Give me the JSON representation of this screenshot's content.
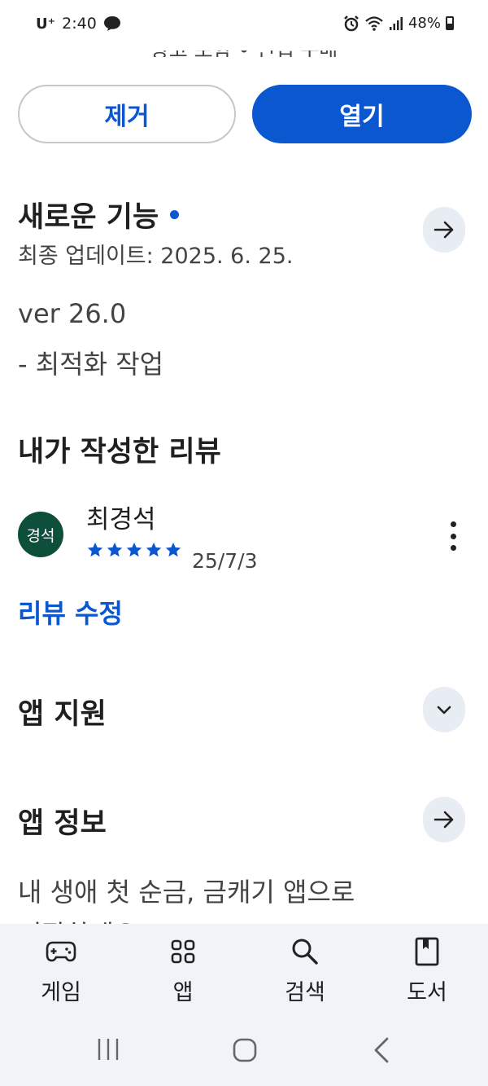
{
  "status_bar": {
    "carrier": "U⁺",
    "time": "2:40",
    "battery": "48%"
  },
  "top_text_cut": "광고 포함 • 인앱 구매",
  "actions": {
    "remove_label": "제거",
    "open_label": "열기"
  },
  "whats_new": {
    "title": "새로운 기능",
    "updated": "최종 업데이트: 2025. 6. 25.",
    "version": "ver 26.0",
    "note": "- 최적화 작업"
  },
  "my_review": {
    "title": "내가 작성한 리뷰",
    "avatar_text": "경석",
    "reviewer": "최경석",
    "rating": 5,
    "date": "25/7/3",
    "edit_label": "리뷰 수정"
  },
  "app_support": {
    "title": "앱 지원"
  },
  "app_info": {
    "title": "앱 정보",
    "desc_line1": "내 생애 첫 순금, 금캐기 앱으로",
    "desc_line2": "시작하세요!"
  },
  "bottom_nav": {
    "items": [
      {
        "label": "게임",
        "icon": "gamepad-icon"
      },
      {
        "label": "앱",
        "icon": "apps-grid-icon"
      },
      {
        "label": "검색",
        "icon": "search-icon"
      },
      {
        "label": "도서",
        "icon": "book-icon"
      }
    ]
  },
  "colors": {
    "accent": "#0b57d0",
    "avatar_bg": "#0d4f3a",
    "circle_btn_bg": "#e8ecf3",
    "nav_bg": "#f0f3f8"
  }
}
